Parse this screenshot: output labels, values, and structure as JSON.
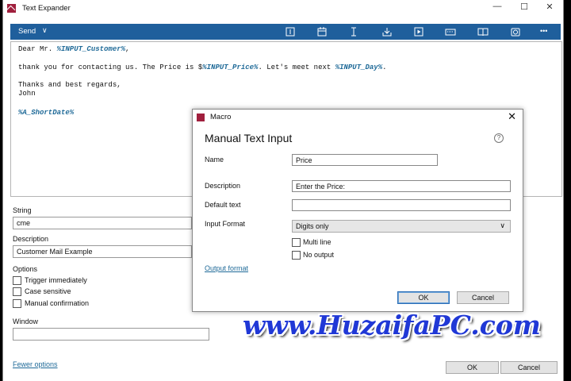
{
  "window": {
    "title": "Text Expander",
    "controls": {
      "minimize": "—",
      "maximize": "☐",
      "close": "✕"
    }
  },
  "toolbar": {
    "send_label": "Send",
    "icons": [
      "text-cursor-icon",
      "calendar-icon",
      "caret-icon",
      "download-icon",
      "play-icon",
      "keyboard-icon",
      "book-icon",
      "camera-icon",
      "more-icon"
    ],
    "more_label": "•••",
    "accent": "#1f5f9c"
  },
  "editor": {
    "line1": {
      "a": "Dear Mr. ",
      "v1": "%INPUT_Customer%",
      "b": ","
    },
    "line2": {
      "a": "thank you for contacting us. The Price is $",
      "v1": "%INPUT_Price%",
      "b": ". Let's meet next ",
      "v2": "%INPUT_Day%",
      "c": "."
    },
    "line3": "Thanks and best regards,",
    "line4": "John",
    "line5": "%A_ShortDate%",
    "var_color": "#1f6a98"
  },
  "form": {
    "string_label": "String",
    "string_value": "cme",
    "description_label": "Description",
    "description_value": "Customer Mail Example",
    "options_label": "Options",
    "options": [
      "Trigger immediately",
      "Case sensitive",
      "Manual confirmation"
    ],
    "window_label": "Window",
    "window_value": "",
    "fewer_options": "Fewer options",
    "ok": "OK",
    "cancel": "Cancel"
  },
  "dialog": {
    "title": "Macro",
    "close": "✕",
    "heading": "Manual Text Input",
    "help": "?",
    "name_label": "Name",
    "name_value": "Price",
    "description_label": "Description",
    "description_value": "Enter the Price:",
    "default_label": "Default text",
    "default_value": "",
    "format_label": "Input Format",
    "format_value": "Digits only",
    "multiline_label": "Multi line",
    "nooutput_label": "No output",
    "output_format": "Output format",
    "ok": "OK",
    "cancel": "Cancel"
  },
  "watermark": "www.HuzaifaPC.com"
}
